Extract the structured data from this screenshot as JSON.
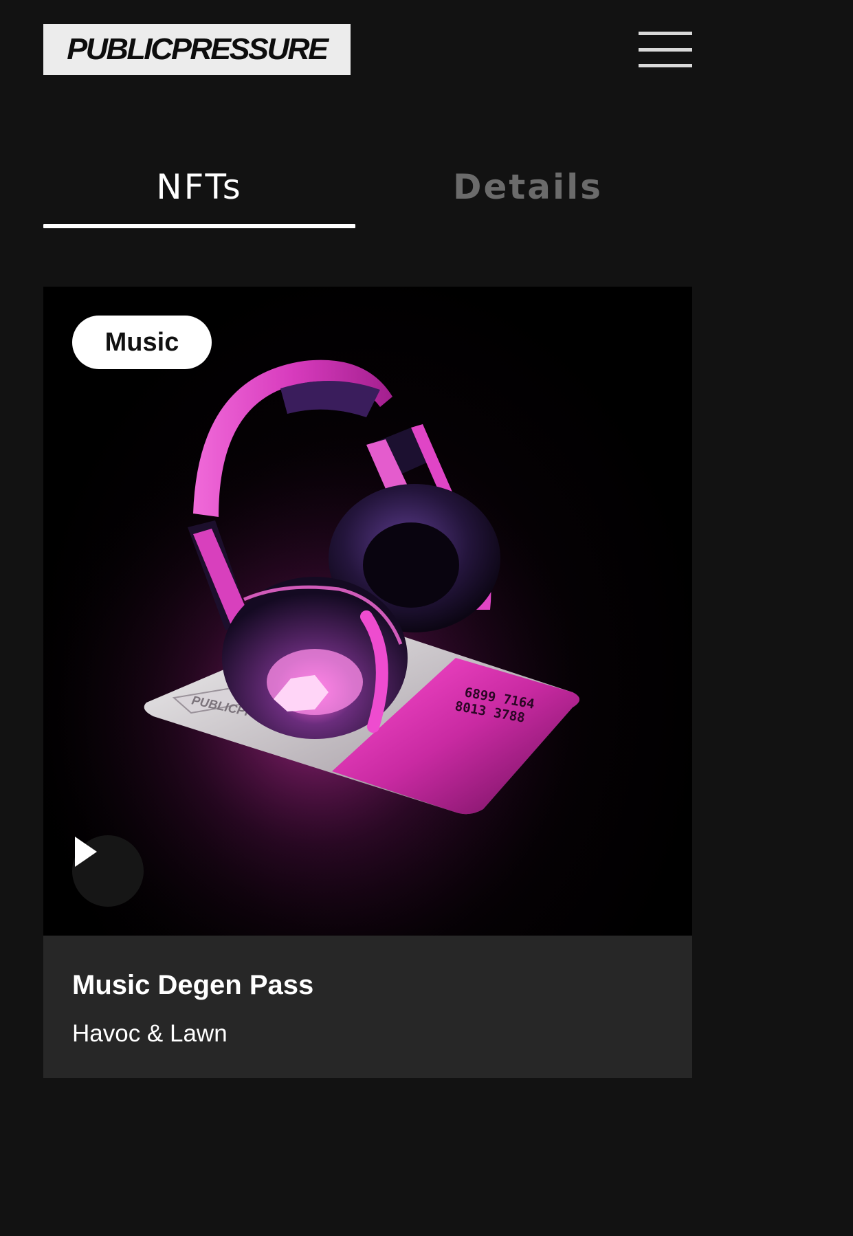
{
  "header": {
    "logo_text": "PUBLICPRESSURE",
    "menu_icon": "hamburger-menu-icon"
  },
  "tabs": [
    {
      "label": "NFTs",
      "active": true
    },
    {
      "label": "Details",
      "active": false
    }
  ],
  "nft_card": {
    "category_badge": "Music",
    "image_icon": "headphones-on-card-artwork",
    "artwork_card_brand": "PUBLICPRESSURE",
    "artwork_card_number_line1": "6899 7164",
    "artwork_card_number_line2": "8013 3788",
    "play_icon": "play-icon",
    "title": "Music Degen Pass",
    "artist": "Havoc & Lawn"
  },
  "colors": {
    "background": "#121212",
    "card_footer": "#272727",
    "accent_pink": "#e23ab8",
    "tab_inactive": "#6b6b6b"
  }
}
